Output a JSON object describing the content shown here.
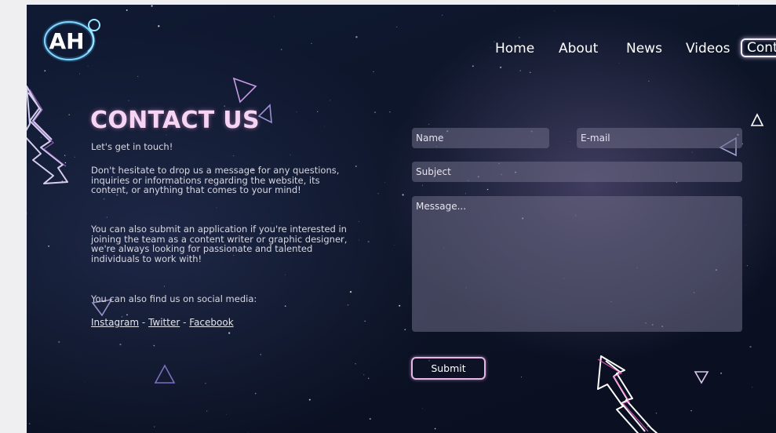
{
  "nav": {
    "items": [
      "Home",
      "About",
      "News",
      "Videos"
    ],
    "active_label": "Cont"
  },
  "brand": {
    "logo_text": "AH"
  },
  "contact": {
    "title": "CONTACT US",
    "greeting": "Let's get in touch!",
    "para1": "Don't hesitate to drop us a message for any questions, inquiries or informations regarding the website, its content, or anything that comes to your mind!",
    "para2": "You can also submit an application if you're interested in joining the team as a content writer or graphic designer, we're always looking for passionate and talented individuals to work with!",
    "social_intro": "You can also find us on social media:",
    "social": {
      "instagram": "Instagram",
      "twitter": "Twitter",
      "facebook": "Facebook",
      "separator": "-"
    }
  },
  "form": {
    "name_placeholder": "Name",
    "email_placeholder": "E-mail",
    "subject_placeholder": "Subject",
    "message_placeholder": "Message...",
    "submit_label": "Submit"
  },
  "colors": {
    "background": "#0d152a",
    "title_pink": "#f6d4f4",
    "field_fill": "#5f5d78",
    "accent_pink": "#e6b6e8",
    "outer_page": "#efeff1"
  }
}
